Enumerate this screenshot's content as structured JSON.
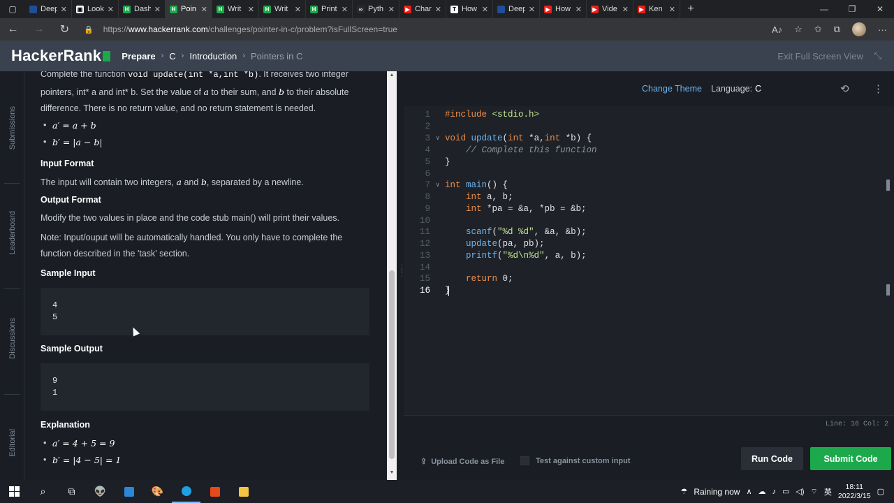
{
  "browser": {
    "tabs": [
      {
        "label": "Deep",
        "color": "#1f4e99",
        "glyph": ""
      },
      {
        "label": "Look",
        "color": "#ffffff",
        "glyph": "▣"
      },
      {
        "label": "Dash",
        "color": "#1ba94c",
        "glyph": "H"
      },
      {
        "label": "Poin",
        "color": "#1ba94c",
        "glyph": "H",
        "active": true
      },
      {
        "label": "Writ",
        "color": "#1ba94c",
        "glyph": "H"
      },
      {
        "label": "Writ",
        "color": "#1ba94c",
        "glyph": "H"
      },
      {
        "label": "Print",
        "color": "#1ba94c",
        "glyph": "H"
      },
      {
        "label": "Pyth",
        "color": "#2a2a2a",
        "glyph": "∞"
      },
      {
        "label": "Char",
        "color": "#e62117",
        "glyph": "▶"
      },
      {
        "label": "How",
        "color": "#ffffff",
        "glyph": "T"
      },
      {
        "label": "Deep",
        "color": "#1f4e99",
        "glyph": ""
      },
      {
        "label": "How",
        "color": "#e62117",
        "glyph": "▶"
      },
      {
        "label": "Vide",
        "color": "#e62117",
        "glyph": "▶"
      },
      {
        "label": "Ken",
        "color": "#e62117",
        "glyph": "▶"
      }
    ],
    "url_prefix": "https://",
    "url_host": "www.hackerrank.com",
    "url_path": "/challenges/pointer-in-c/problem?isFullScreen=true"
  },
  "header": {
    "logo": "HackerRank",
    "crumb_prepare": "Prepare",
    "crumb_c": "C",
    "crumb_intro": "Introduction",
    "crumb_current": "Pointers in C",
    "exit_fullscreen": "Exit Full Screen View"
  },
  "rail": {
    "submissions": "Submissions",
    "leaderboard": "Leaderboard",
    "discussions": "Discussions",
    "editorial": "Editorial"
  },
  "problem": {
    "intro_1": "Complete the function ",
    "intro_fn": "void update(int *a,int *b)",
    "intro_2": ". It receives two integer",
    "intro_line2a": "pointers, int* a and int* b. Set the value of ",
    "intro_var_a": "a",
    "intro_line2b": " to their sum, and ",
    "intro_var_b": "b",
    "intro_line2c": " to their absolute",
    "intro_line3": "difference. There is no return value, and no return statement is needed.",
    "bullet_1": "a′ = a + b",
    "bullet_2": "b′ = |a − b|",
    "input_format_heading": "Input Format",
    "input_format_a": "The input will contain two integers, ",
    "input_format_var_a": "a",
    "input_format_b": " and ",
    "input_format_var_b": "b",
    "input_format_c": ", separated by a newline.",
    "output_format_heading": "Output Format",
    "output_format_text": "Modify the two values in place and the code stub main() will print their values.",
    "note_line1": "Note: Input/ouput will be automatically handled. You only have to complete the",
    "note_line2": "function described in the 'task' section.",
    "sample_input_heading": "Sample Input",
    "sample_input": [
      "4",
      "5"
    ],
    "sample_output_heading": "Sample Output",
    "sample_output": [
      "9",
      "1"
    ],
    "explanation_heading": "Explanation",
    "explanation_1": "a′ = 4 + 5 = 9",
    "explanation_2": "b′ = |4 − 5| = 1"
  },
  "editor": {
    "change_theme": "Change Theme",
    "language_label": "Language:",
    "language_value": "C",
    "line_numbers": [
      "1",
      "2",
      "3",
      "4",
      "5",
      "6",
      "7",
      "8",
      "9",
      "10",
      "11",
      "12",
      "13",
      "14",
      "15",
      "16"
    ],
    "status": "Line: 16 Col: 2"
  },
  "actions": {
    "upload": "Upload Code as File",
    "custom_input": "Test against custom input",
    "run": "Run Code",
    "submit": "Submit Code"
  },
  "taskbar": {
    "weather": "Raining now",
    "ime": "英",
    "time": "18:11",
    "date": "2022/3/15"
  }
}
